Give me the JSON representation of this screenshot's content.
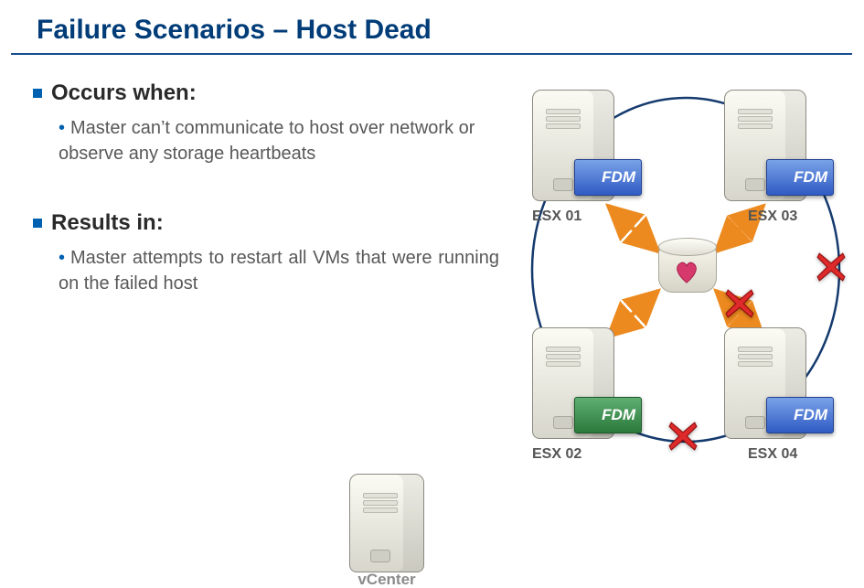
{
  "title": "Failure Scenarios – Host Dead",
  "sections": {
    "occurs": {
      "heading": "Occurs when:",
      "item": "Master can’t communicate to host over network or observe any storage heartbeats"
    },
    "results": {
      "heading": "Results in:",
      "item": "Master attempts to restart all VMs that were running on the failed host"
    }
  },
  "hosts": {
    "esx01": {
      "label": "ESX 01",
      "fdm_label": "FDM",
      "fdm_color": "blue"
    },
    "esx02": {
      "label": "ESX 02",
      "fdm_label": "FDM",
      "fdm_color": "green"
    },
    "esx03": {
      "label": "ESX 03",
      "fdm_label": "FDM",
      "fdm_color": "blue"
    },
    "esx04": {
      "label": "ESX 04",
      "fdm_label": "FDM",
      "fdm_color": "blue"
    }
  },
  "vcenter_label": "vCenter",
  "icons": {
    "heart": "heart-icon",
    "x": "red-x-icon",
    "arrow": "double-arrow-icon"
  },
  "colors": {
    "accent": "#003c78",
    "bullet": "#0061b0",
    "x_fill": "#de2a2a",
    "arrow": "#ec8a1f"
  }
}
